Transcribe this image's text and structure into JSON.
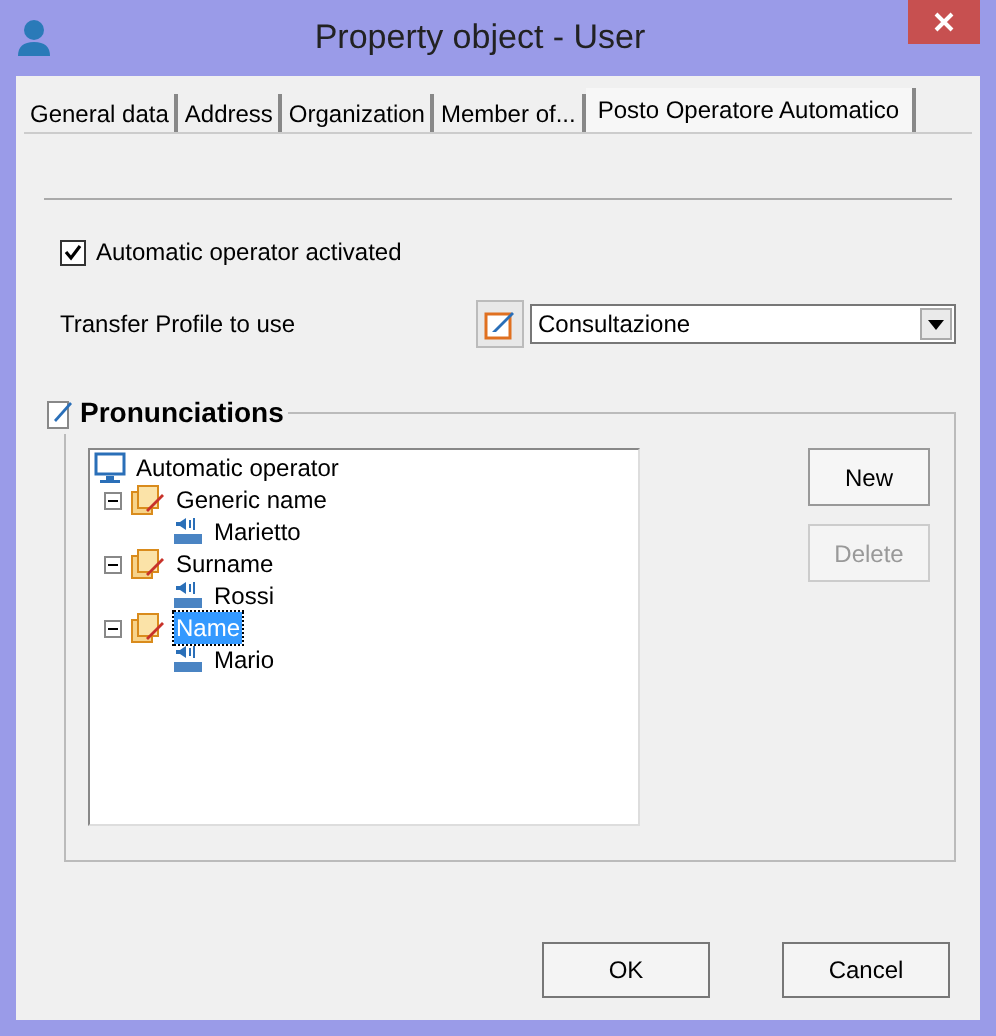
{
  "window": {
    "title": "Property object - User"
  },
  "tabs": [
    {
      "label": "General data",
      "selected": false
    },
    {
      "label": "Address",
      "selected": false
    },
    {
      "label": "Organization",
      "selected": false
    },
    {
      "label": "Member of...",
      "selected": false
    },
    {
      "label": "Posto Operatore Automatico",
      "selected": true
    }
  ],
  "auto_operator": {
    "label": "Automatic operator activated",
    "checked": true
  },
  "transfer_profile": {
    "label": "Transfer Profile to use",
    "value": "Consultazione"
  },
  "pronunciations": {
    "title": "Pronunciations",
    "tree": [
      {
        "label": "Automatic operator",
        "kind": "root",
        "selected": false,
        "children": [
          {
            "label": "Generic name",
            "kind": "group",
            "expanded": true,
            "selected": false,
            "children": [
              {
                "label": "Marietto",
                "kind": "voice",
                "selected": false
              }
            ]
          },
          {
            "label": "Surname",
            "kind": "group",
            "expanded": true,
            "selected": false,
            "children": [
              {
                "label": "Rossi",
                "kind": "voice",
                "selected": false
              }
            ]
          },
          {
            "label": "Name",
            "kind": "group",
            "expanded": true,
            "selected": true,
            "children": [
              {
                "label": "Mario",
                "kind": "voice",
                "selected": false
              }
            ]
          }
        ]
      }
    ],
    "buttons": [
      {
        "label": "New",
        "disabled": false
      },
      {
        "label": "Delete",
        "disabled": true
      }
    ]
  },
  "footer_buttons": [
    {
      "label": "OK"
    },
    {
      "label": "Cancel"
    }
  ]
}
